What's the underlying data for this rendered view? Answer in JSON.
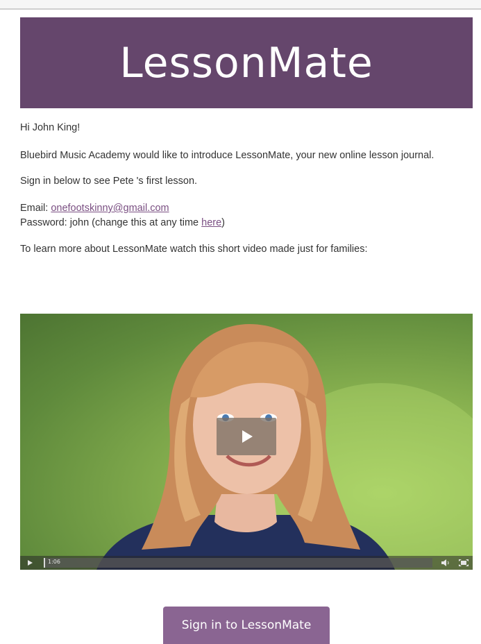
{
  "header": {
    "brand": "LessonMate"
  },
  "body": {
    "greeting": "Hi John King!",
    "intro": "Bluebird Music Academy would like to introduce LessonMate, your new online lesson journal.",
    "signin_line": "Sign in below to see Pete 's first lesson.",
    "email_label": "Email: ",
    "email_value": "onefootskinny@gmail.com",
    "password_label": "Password: john (change this at any time ",
    "password_link": "here",
    "password_suffix": ")",
    "video_line": "To learn more about LessonMate watch this short video made just for families:"
  },
  "video": {
    "time": "1:06",
    "play_icon": "play-icon",
    "volume_icon": "volume-icon",
    "fullscreen_icon": "fullscreen-icon",
    "background_color": "#8bb451"
  },
  "cta": {
    "label": "Sign in to LessonMate"
  },
  "colors": {
    "brand": "#65466c",
    "button": "#8a6592",
    "link": "#7a4f82"
  }
}
